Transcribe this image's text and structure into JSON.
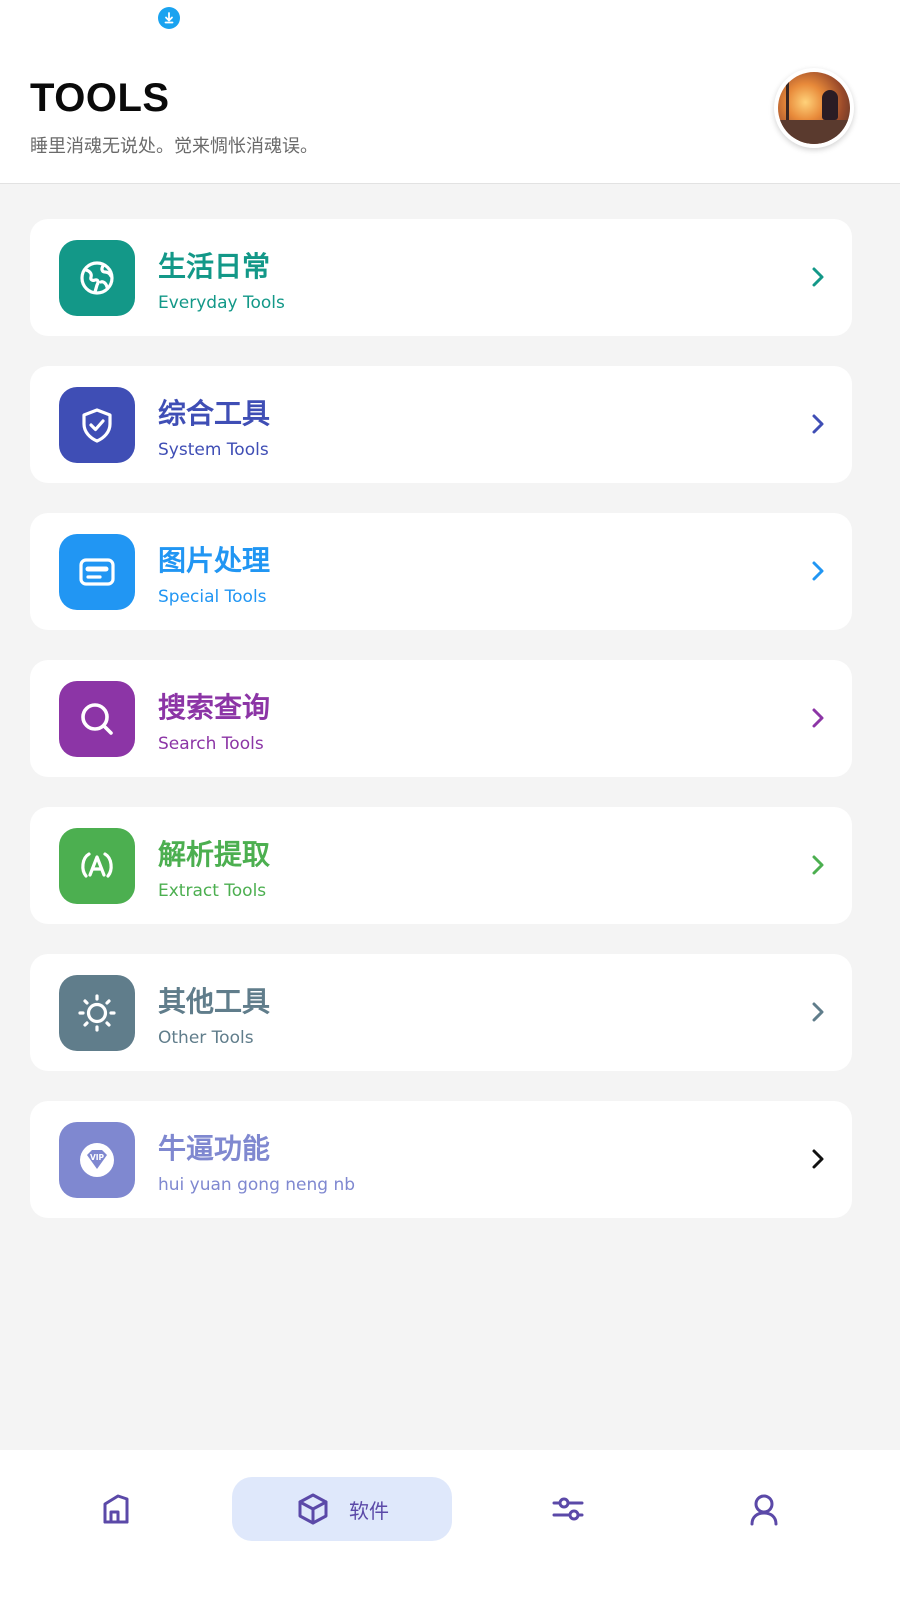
{
  "header": {
    "title": "TOOLS",
    "subtitle": "睡里消魂无说处。觉来惆怅消魂误。"
  },
  "colors": {
    "everyday": "#139888",
    "system": "#3f4eb5",
    "special": "#2196f3",
    "search": "#8c35a6",
    "extract": "#4caf50",
    "other": "#607d8b",
    "vip": "#7f88d0",
    "nav_accent": "#5b49a8"
  },
  "tools": [
    {
      "title": "生活日常",
      "subtitle": "Everyday Tools",
      "icon": "globe-icon"
    },
    {
      "title": "综合工具",
      "subtitle": "System Tools",
      "icon": "shield-check-icon"
    },
    {
      "title": "图片处理",
      "subtitle": "Special Tools",
      "icon": "card-icon"
    },
    {
      "title": "搜索查询",
      "subtitle": "Search Tools",
      "icon": "search-icon"
    },
    {
      "title": "解析提取",
      "subtitle": "Extract Tools",
      "icon": "letter-a-icon"
    },
    {
      "title": "其他工具",
      "subtitle": "Other Tools",
      "icon": "sun-icon"
    },
    {
      "title": "牛逼功能",
      "subtitle": "hui yuan gong neng nb",
      "icon": "vip-diamond-icon"
    }
  ],
  "bottom_nav": {
    "items": [
      {
        "icon": "home-icon"
      },
      {
        "icon": "cube-icon",
        "label": "软件",
        "active": true
      },
      {
        "icon": "sliders-icon"
      },
      {
        "icon": "user-icon"
      }
    ]
  }
}
